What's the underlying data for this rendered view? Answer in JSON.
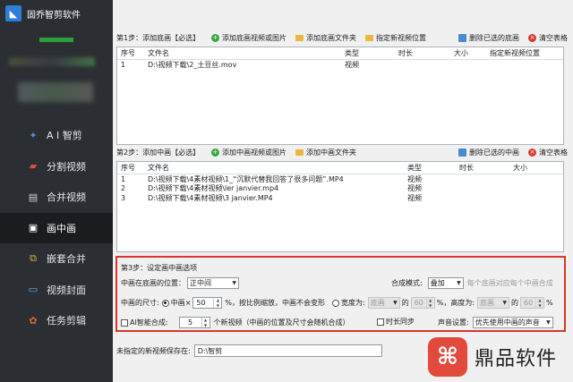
{
  "app": {
    "title": "固乔智剪软件"
  },
  "sidebar": {
    "items": [
      {
        "label": "A I 智剪",
        "icon": "ai-cut-icon"
      },
      {
        "label": "分割视频",
        "icon": "split-icon"
      },
      {
        "label": "合并视频",
        "icon": "merge-icon"
      },
      {
        "label": "画中画",
        "icon": "pip-icon"
      },
      {
        "label": "嵌套合并",
        "icon": "nest-icon"
      },
      {
        "label": "视频封面",
        "icon": "cover-icon"
      },
      {
        "label": "任务剪辑",
        "icon": "task-icon"
      }
    ]
  },
  "step1": {
    "label": "第1步：添加底画【必选】",
    "add_video": "添加底画视频或图片",
    "add_folder": "添加底画文件夹",
    "set_location": "指定新视频位置",
    "delete_selected": "删除已选的底画",
    "clear_table": "清空表格",
    "columns": [
      "序号",
      "文件名",
      "类型",
      "时长",
      "大小",
      "指定新视频位置"
    ],
    "rows": [
      [
        "1",
        "D:\\视频下载\\2_土豆丝.mov",
        "视频",
        "",
        "",
        ""
      ]
    ]
  },
  "step2": {
    "label": "第2步：添加中画【必选】",
    "add_video": "添加中画视频或图片",
    "add_folder": "添加中画文件夹",
    "delete_selected": "删除已选的中画",
    "clear_table": "清空表格",
    "columns": [
      "序号",
      "文件名",
      "类型",
      "时长",
      "大小"
    ],
    "rows": [
      [
        "1",
        "D:\\视频下载\\4素材视频\\1_“沉默代替我回答了很多问题”.MP4",
        "视频",
        "",
        ""
      ],
      [
        "2",
        "D:\\视频下载\\4素材视频\\ler janvier.mp4",
        "视频",
        "",
        ""
      ],
      [
        "3",
        "D:\\视频下载\\4素材视频\\3 janvier.MP4",
        "视频",
        "",
        ""
      ]
    ]
  },
  "step3": {
    "label": "第3步：设定画中画选项",
    "position_label": "中画在底画的位置：",
    "position_value": "正中间",
    "blend_label": "合成模式:",
    "blend_value": "叠加",
    "blend_hint": "每个底画对应每个中画合成",
    "size_label": "中画的尺寸:",
    "scale_option": "中画×",
    "scale_value": "50",
    "scale_suffix": "%，按比例缩放，中画不会变形",
    "width_option": "宽度为:",
    "width_ref": "底画",
    "width_of": "的",
    "width_pct": "60",
    "height_option": "%，高度为:",
    "height_ref": "底画",
    "height_of": "的",
    "height_pct": "60",
    "pct_sign": "%",
    "ai_label": "AI智能合成:",
    "ai_value": "5",
    "ai_suffix": "个新视频（中画的位置及尺寸会随机合成）",
    "sync_label": "时长同步",
    "audio_label": "声音设置:",
    "audio_value": "优先使用中画的声音"
  },
  "save": {
    "label": "未指定的新视频保存在:",
    "path": "D:\\智剪"
  },
  "watermark": {
    "text": "鼎品软件"
  },
  "colors": {
    "sidebar_bg": "#2b2e33",
    "highlight_border": "#d9372b",
    "accent_green": "#3aa540"
  }
}
